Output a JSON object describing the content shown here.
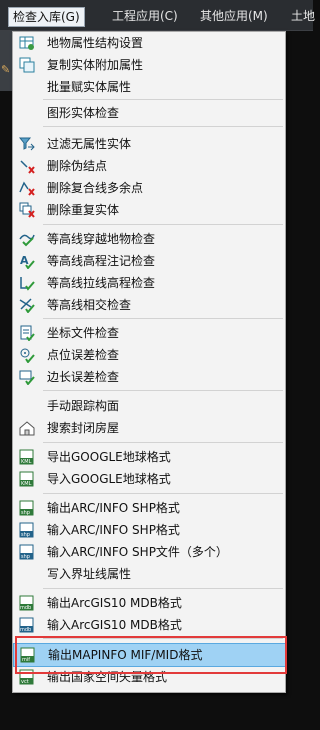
{
  "menubar": {
    "items": [
      "检查入库(G)",
      "工程应用(C)",
      "其他应用(M)",
      "土地"
    ],
    "active_index": 0
  },
  "menu": {
    "items": [
      {
        "label": "地物属性结构设置",
        "icon": "table-settings-icon"
      },
      {
        "label": "复制实体附加属性",
        "icon": "copy-attributes-icon"
      },
      {
        "label": "批量赋实体属性",
        "icon": ""
      },
      {
        "label": "图形实体检查",
        "icon": ""
      },
      {
        "label": "过滤无属性实体",
        "icon": "filter-entity-icon"
      },
      {
        "label": "删除伪结点",
        "icon": "delete-node-icon"
      },
      {
        "label": "删除复合线多余点",
        "icon": "delete-polyline-points-icon"
      },
      {
        "label": "删除重复实体",
        "icon": "delete-duplicate-icon"
      },
      {
        "label": "等高线穿越地物检查",
        "icon": "contour-cross-check-icon"
      },
      {
        "label": "等高线高程注记检查",
        "icon": "contour-annotation-check-icon"
      },
      {
        "label": "等高线拉线高程检查",
        "icon": "contour-line-check-icon"
      },
      {
        "label": "等高线相交检查",
        "icon": "contour-intersect-check-icon"
      },
      {
        "label": "坐标文件检查",
        "icon": "coordinate-file-check-icon"
      },
      {
        "label": "点位误差检查",
        "icon": "point-error-check-icon"
      },
      {
        "label": "边长误差检查",
        "icon": "edge-error-check-icon"
      },
      {
        "label": "手动跟踪构面",
        "icon": ""
      },
      {
        "label": "搜索封闭房屋",
        "icon": "house-search-icon"
      },
      {
        "label": "导出GOOGLE地球格式",
        "icon": "kml-export-icon"
      },
      {
        "label": "导入GOOGLE地球格式",
        "icon": "kml-import-icon"
      },
      {
        "label": "输出ARC/INFO SHP格式",
        "icon": "shp-export-icon"
      },
      {
        "label": "输入ARC/INFO SHP格式",
        "icon": "shp-import-icon"
      },
      {
        "label": "输入ARC/INFO SHP文件（多个）",
        "icon": "shp-import-multiple-icon"
      },
      {
        "label": "写入界址线属性",
        "icon": ""
      },
      {
        "label": "输出ArcGIS10 MDB格式",
        "icon": "mdb-export-icon"
      },
      {
        "label": "输入ArcGIS10 MDB格式",
        "icon": "mdb-import-icon"
      },
      {
        "label": "输出MAPINFO MIF/MID格式",
        "icon": "mif-export-icon"
      },
      {
        "label": "输出国家空间矢量格式",
        "icon": "vct-export-icon"
      }
    ],
    "selected_index": 25
  }
}
